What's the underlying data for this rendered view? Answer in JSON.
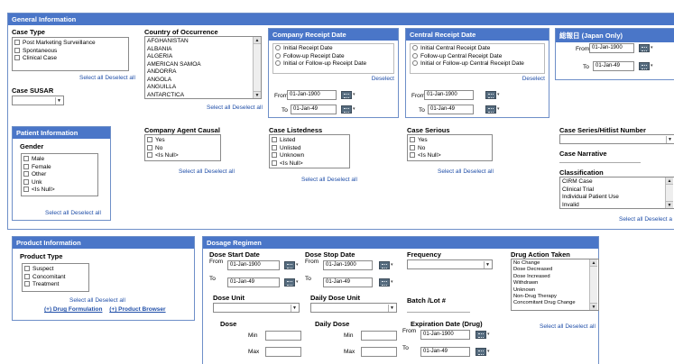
{
  "general": {
    "title": "General Information",
    "case_type": {
      "label": "Case Type",
      "options": [
        "Post Marketing Surveillance",
        "Spontaneous",
        "Clinical Case"
      ],
      "select_all": "Select all",
      "deselect_all": "Deselect all"
    },
    "case_susar": {
      "label": "Case SUSAR"
    },
    "country": {
      "label": "Country of Occurrence",
      "options": [
        "AFGHANISTAN",
        "ALBANIA",
        "ALGERIA",
        "AMERICAN SAMOA",
        "ANDORRA",
        "ANGOLA",
        "ANGUILLA",
        "ANTARCTICA"
      ],
      "select_all": "Select all",
      "deselect_all": "Deselect all"
    },
    "company_receipt": {
      "title": "Company Receipt Date",
      "options": [
        "Initial Receipt Date",
        "Follow-up Receipt Date",
        "Initial or Follow-up Receipt Date"
      ],
      "deselect": "Deselect",
      "from_label": "From",
      "from_value": "01-Jan-1900",
      "to_label": "To",
      "to_value": "01-Jan-49"
    },
    "central_receipt": {
      "title": "Central Receipt Date",
      "options": [
        "Initial Central Receipt Date",
        "Follow-up Central Receipt Date",
        "Initial or Follow-up Central Receipt Date"
      ],
      "deselect": "Deselect",
      "from_label": "From",
      "from_value": "01-Jan-1900",
      "to_label": "To",
      "to_value": "01-Jan-49"
    },
    "japan": {
      "title": "総報日 (Japan Only)",
      "from_label": "From",
      "from_value": "01-Jan-1900",
      "to_label": "To",
      "to_value": "01-Jan-49"
    },
    "company_agent_causal": {
      "label": "Company Agent Causal",
      "options": [
        "Yes",
        "No",
        "<Is Null>"
      ],
      "select_all": "Select all",
      "deselect_all": "Deselect all"
    },
    "case_listedness": {
      "label": "Case Listedness",
      "options": [
        "Listed",
        "Unlisted",
        "Unknown",
        "<Is Null>"
      ],
      "select_all": "Select all",
      "deselect_all": "Deselect all"
    },
    "case_serious": {
      "label": "Case Serious",
      "options": [
        "Yes",
        "No",
        "<Is Null>"
      ],
      "select_all": "Select all",
      "deselect_all": "Deselect all"
    },
    "case_series": {
      "label": "Case Series/Hitlist Number"
    },
    "case_narrative": {
      "label": "Case Narrative"
    },
    "classification": {
      "label": "Classification",
      "options": [
        "CIRM Case",
        "Clinical Trial",
        "Individual Patient Use",
        "Invalid"
      ],
      "select_all": "Select all",
      "deselect_all": "Deselect a"
    }
  },
  "patient": {
    "title": "Patient Information",
    "gender": {
      "label": "Gender",
      "options": [
        "Male",
        "Female",
        "Other",
        "Unk",
        "<Is Null>"
      ],
      "select_all": "Select all",
      "deselect_all": "Deselect all"
    }
  },
  "product": {
    "title": "Product Information",
    "product_type": {
      "label": "Product Type",
      "options": [
        "Suspect",
        "Concomitant",
        "Treatment"
      ],
      "select_all": "Select all",
      "deselect_all": "Deselect all"
    },
    "drug_formulation_link": "(+) Drug Formulation",
    "product_browser_link": "(+) Product Browser"
  },
  "dosage": {
    "title": "Dosage Regimen",
    "dose_start": {
      "label": "Dose Start Date",
      "from_label": "From",
      "from_value": "01-Jan-1900",
      "to_label": "To",
      "to_value": "01-Jan-49"
    },
    "dose_stop": {
      "label": "Dose Stop Date",
      "from_label": "From",
      "from_value": "01-Jan-1900",
      "to_label": "To",
      "to_value": "01-Jan-49"
    },
    "frequency": {
      "label": "Frequency"
    },
    "drug_action": {
      "label": "Drug Action Taken",
      "options": [
        "No Change",
        "Dose Decreased",
        "Dose Increased",
        "Withdrawn",
        "Unknown",
        "Non-Drug Therapy",
        "Concomitant Drug Change"
      ],
      "select_all": "Select all",
      "deselect_all": "Deselect all"
    },
    "dose_unit": {
      "label": "Dose Unit"
    },
    "daily_dose_unit": {
      "label": "Daily Dose Unit"
    },
    "batch_lot": {
      "label": "Batch /Lot #"
    },
    "dose": {
      "label": "Dose",
      "min_label": "Min",
      "max_label": "Max"
    },
    "daily_dose": {
      "label": "Daily Dose",
      "min_label": "Min",
      "max_label": "Max"
    },
    "expiration": {
      "label": "Expiration Date (Drug)",
      "from_label": "From",
      "from_value": "01-Jan-1900",
      "to_label": "To",
      "to_value": "01-Jan-49"
    }
  }
}
